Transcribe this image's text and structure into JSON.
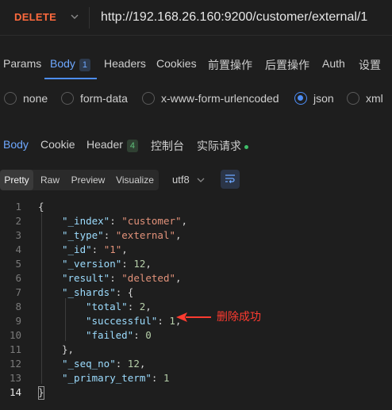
{
  "request": {
    "method": "DELETE",
    "url": "http://192.168.26.160:9200/customer/external/1"
  },
  "request_tabs": [
    {
      "label": "Params"
    },
    {
      "label": "Body",
      "badge": "1",
      "active": true
    },
    {
      "label": "Headers"
    },
    {
      "label": "Cookies"
    },
    {
      "label": "前置操作"
    },
    {
      "label": "后置操作"
    },
    {
      "label": "Auth"
    },
    {
      "label": "设置"
    }
  ],
  "body_types": [
    {
      "label": "none"
    },
    {
      "label": "form-data"
    },
    {
      "label": "x-www-form-urlencoded"
    },
    {
      "label": "json",
      "checked": true
    },
    {
      "label": "xml"
    }
  ],
  "response_tabs": [
    {
      "label": "Body",
      "active": true
    },
    {
      "label": "Cookie"
    },
    {
      "label": "Header",
      "badge": "4"
    },
    {
      "label": "控制台"
    },
    {
      "label": "实际请求"
    }
  ],
  "view_modes": [
    {
      "label": "Pretty",
      "active": true
    },
    {
      "label": "Raw"
    },
    {
      "label": "Preview"
    },
    {
      "label": "Visualize"
    }
  ],
  "encoding": "utf8",
  "code_lines": [
    {
      "num": "1",
      "text": "{"
    },
    {
      "num": "2",
      "text": "\"_index\": \"customer\","
    },
    {
      "num": "3",
      "text": "\"_type\": \"external\","
    },
    {
      "num": "4",
      "text": "\"_id\": \"1\","
    },
    {
      "num": "5",
      "text": "\"_version\": 12,"
    },
    {
      "num": "6",
      "text": "\"result\": \"deleted\","
    },
    {
      "num": "7",
      "text": "\"_shards\": {"
    },
    {
      "num": "8",
      "text": "\"total\": 2,"
    },
    {
      "num": "9",
      "text": "\"successful\": 1,"
    },
    {
      "num": "10",
      "text": "\"failed\": 0"
    },
    {
      "num": "11",
      "text": "},"
    },
    {
      "num": "12",
      "text": "\"_seq_no\": 12,"
    },
    {
      "num": "13",
      "text": "\"_primary_term\": 1"
    },
    {
      "num": "14",
      "text": "}"
    }
  ],
  "annotation": "删除成功",
  "colors": {
    "method": "#ff6a3d",
    "accent": "#4d8df5",
    "json_key": "#9cdcfe",
    "json_string": "#e2927a",
    "json_number": "#b5cea8",
    "annotation": "#ff3b30"
  }
}
